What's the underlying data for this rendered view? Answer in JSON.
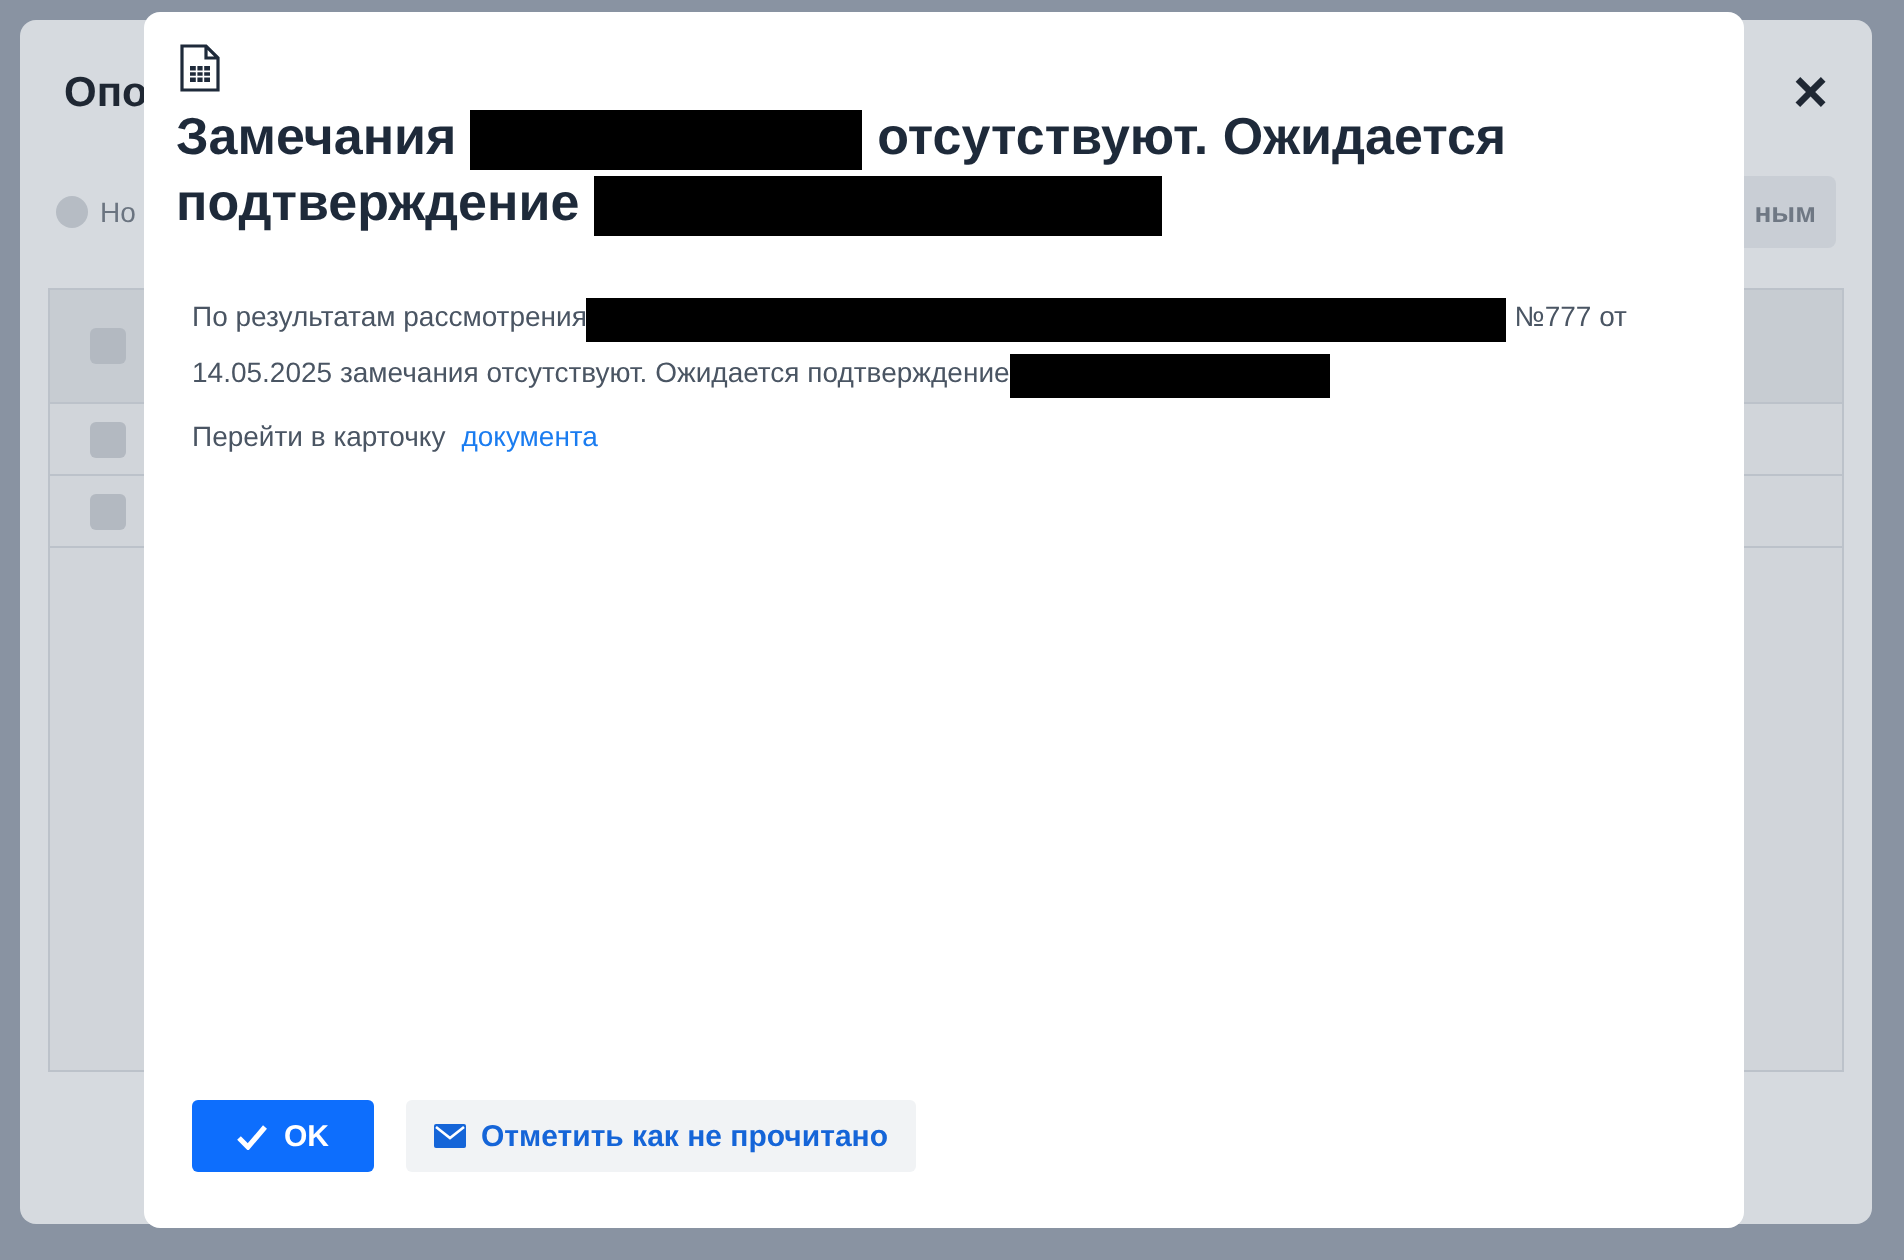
{
  "background_dialog": {
    "title": "Опо",
    "close": "×",
    "radio": {
      "label": "Но",
      "selected": false
    },
    "button": "ным",
    "table": {
      "header_checkbox": {
        "checked": false
      },
      "rows": [
        {
          "checked": false
        },
        {
          "checked": false
        }
      ]
    }
  },
  "modal": {
    "title": [
      {
        "kind": "text",
        "text": "Замечания "
      },
      {
        "kind": "redacted"
      },
      {
        "kind": "text",
        "text": " отсутствуют. Ожидается подтверждение "
      },
      {
        "kind": "redacted"
      }
    ],
    "message": [
      {
        "kind": "text",
        "text": "По результатам рассмотрения"
      },
      {
        "kind": "redacted"
      },
      {
        "kind": "text",
        "text": " №777 от 14.05.2025 замечания отсутствуют. Ожидается подтверждение"
      },
      {
        "kind": "redacted"
      }
    ],
    "link_prefix": "Перейти в карточку",
    "link": "документа",
    "buttons": [
      {
        "kind": "primary",
        "label": "OK"
      },
      {
        "kind": "secondary",
        "label": "Отметить как не прочитано"
      }
    ]
  }
}
